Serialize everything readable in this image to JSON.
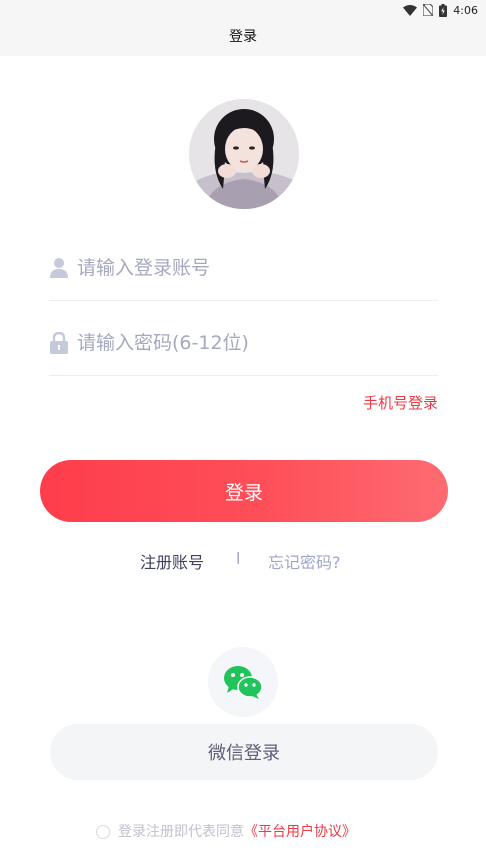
{
  "status_bar": {
    "time": "4:06"
  },
  "header": {
    "title": "登录"
  },
  "login_form": {
    "account_placeholder": "请输入登录账号",
    "password_placeholder": "请输入密码(6-12位)",
    "phone_login_label": "手机号登录",
    "submit_label": "登录"
  },
  "links": {
    "register_label": "注册账号",
    "separator": "l",
    "forgot_label": "忘记密码?"
  },
  "social": {
    "wechat_label": "微信登录"
  },
  "agreement": {
    "prefix": "登录注册即代表同意",
    "link_label": "《平台用户协议》"
  },
  "colors": {
    "accent": "#fe4450",
    "wechat_green": "#21c35b",
    "placeholder": "#a5a8c0"
  },
  "icons": {
    "account": "user-icon",
    "password": "lock-icon",
    "social": "wechat-icon"
  }
}
